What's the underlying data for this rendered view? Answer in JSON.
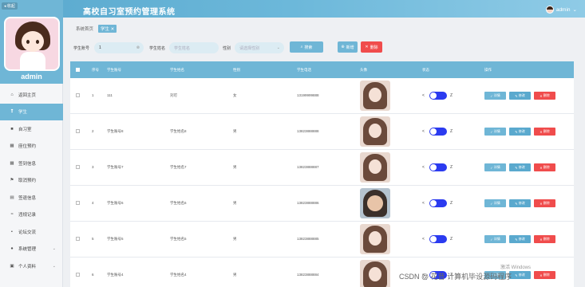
{
  "app": {
    "title": "高校自习室预约管理系统",
    "fold_label": "收起",
    "user": "admin"
  },
  "sidebar": {
    "user_name": "admin",
    "items": [
      {
        "label": "返回主页",
        "icon": "home-icon",
        "glyph": "⌂"
      },
      {
        "label": "学生",
        "icon": "user-icon",
        "glyph": "❢",
        "active": true
      },
      {
        "label": "自习室",
        "icon": "room-icon",
        "glyph": "■"
      },
      {
        "label": "座位预约",
        "icon": "grid-icon",
        "glyph": "▦"
      },
      {
        "label": "签到信息",
        "icon": "grid-icon",
        "glyph": "▦"
      },
      {
        "label": "取消预约",
        "icon": "flag-icon",
        "glyph": "⚑"
      },
      {
        "label": "签退信息",
        "icon": "doc-icon",
        "glyph": "▤"
      },
      {
        "label": "违规记录",
        "icon": "tag-icon",
        "glyph": "≈"
      },
      {
        "label": "论坛交流",
        "icon": "chat-icon",
        "glyph": "▪"
      },
      {
        "label": "系统管理",
        "icon": "gear-icon",
        "glyph": "●",
        "arrow": "⌄"
      },
      {
        "label": "个人资料",
        "icon": "profile-icon",
        "glyph": "▣",
        "arrow": "⌄"
      }
    ]
  },
  "breadcrumb": {
    "home": "系统首页",
    "current": "学生"
  },
  "search": {
    "account_label": "学生账号",
    "account_value": "1",
    "name_label": "学生姓名",
    "name_placeholder": "学生姓名",
    "gender_label": "性别",
    "gender_placeholder": "请选择性别",
    "search_btn": "搜索",
    "add_btn": "新增",
    "delete_btn": "删除"
  },
  "table": {
    "headers": [
      "序号",
      "学生账号",
      "学生姓名",
      "性别",
      "学生电话",
      "头像",
      "状态",
      "操作"
    ],
    "actions": {
      "detail": "详情",
      "edit": "修改",
      "delete": "删除"
    },
    "toggle_left": "<",
    "toggle_right": "Z",
    "rows": [
      {
        "idx": "1",
        "account": "111",
        "name": "刘可",
        "gender": "女",
        "phone": "13199999888",
        "photo": "girl"
      },
      {
        "idx": "2",
        "account": "学生账号8",
        "name": "学生姓名8",
        "gender": "男",
        "phone": "13823888888",
        "photo": "girl"
      },
      {
        "idx": "3",
        "account": "学生账号7",
        "name": "学生姓名7",
        "gender": "男",
        "phone": "13823888887",
        "photo": "girl"
      },
      {
        "idx": "4",
        "account": "学生账号6",
        "name": "学生姓名6",
        "gender": "男",
        "phone": "13823888886",
        "photo": "cartoon"
      },
      {
        "idx": "5",
        "account": "学生账号5",
        "name": "学生姓名5",
        "gender": "男",
        "phone": "13823888885",
        "photo": "girl"
      },
      {
        "idx": "6",
        "account": "学生账号4",
        "name": "学生姓名4",
        "gender": "男",
        "phone": "13823888884",
        "photo": "girl"
      }
    ]
  },
  "overlay": {
    "watermark": "CSDN @ 花昔 计算机毕设源码程序",
    "windows": "激活 Windows"
  }
}
